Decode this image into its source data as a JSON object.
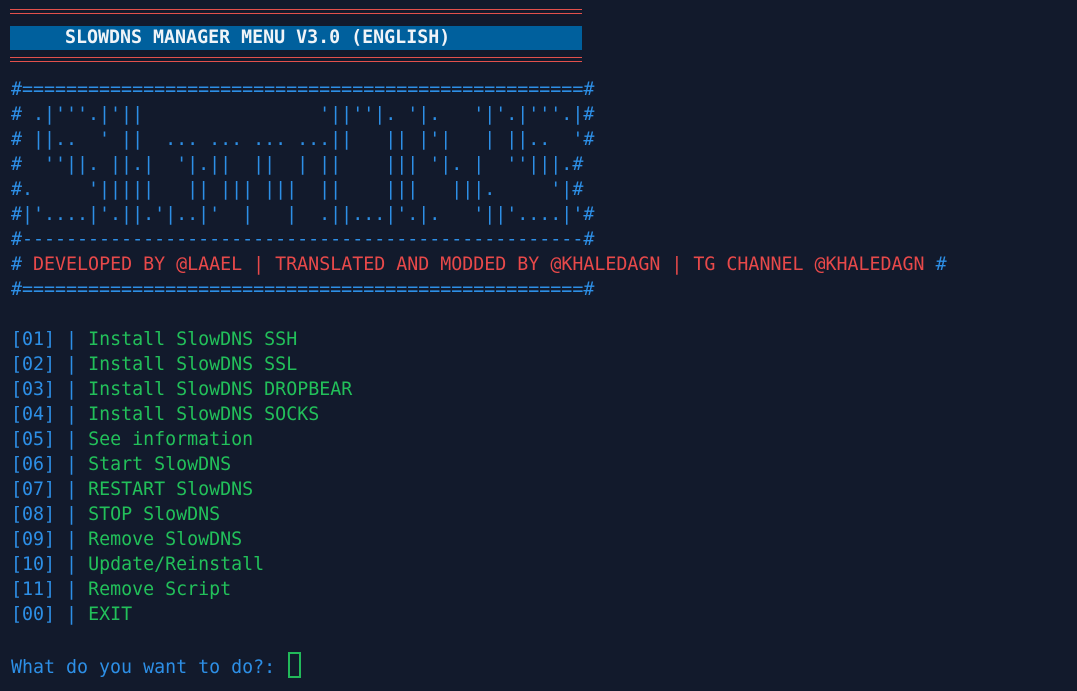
{
  "header": {
    "title": "SLOWDNS MANAGER MENU V3.0 (ENGLISH)"
  },
  "banner": {
    "border_top": "#===================================================#",
    "art": [
      "# .|'''.|'||                '||''|. '|.   '|'.|'''.|#",
      "# ||..  ' ||  ... ... ... ...||   || |'|   | ||..  '#",
      "#  ''||. ||.|  '|.||  ||  | ||    ||| '|. |  ''|||.#",
      "#.     '|||||   || ||| |||  ||    |||   |||.     '|#",
      "#|'....|'.||.'|..|'  |   |  .||...|'.|.   '||'....|'#"
    ],
    "border_mid": "#---------------------------------------------------#",
    "credits_prefix": "#",
    "credits": "DEVELOPED BY @LAAEL | TRANSLATED AND MODDED BY @KHALEDAGN | TG CHANNEL @KHALEDAGN",
    "credits_suffix": "#",
    "border_bottom": "#===================================================#"
  },
  "menu": [
    {
      "num": "[01]",
      "label": "Install SlowDNS SSH"
    },
    {
      "num": "[02]",
      "label": "Install SlowDNS SSL"
    },
    {
      "num": "[03]",
      "label": "Install SlowDNS DROPBEAR"
    },
    {
      "num": "[04]",
      "label": "Install SlowDNS SOCKS"
    },
    {
      "num": "[05]",
      "label": "See information"
    },
    {
      "num": "[06]",
      "label": "Start SlowDNS"
    },
    {
      "num": "[07]",
      "label": "RESTART SlowDNS"
    },
    {
      "num": "[08]",
      "label": "STOP SlowDNS"
    },
    {
      "num": "[09]",
      "label": "Remove SlowDNS"
    },
    {
      "num": "[10]",
      "label": "Update/Reinstall"
    },
    {
      "num": "[11]",
      "label": "Remove Script"
    },
    {
      "num": "[00]",
      "label": "EXIT"
    }
  ],
  "separator": "|",
  "prompt": {
    "text": "What do you want to do?:"
  },
  "colors": {
    "background": "#121a2c",
    "title_bar": "#00609d",
    "blue": "#2d8fe6",
    "red": "#e8494a",
    "green": "#22c05a"
  }
}
